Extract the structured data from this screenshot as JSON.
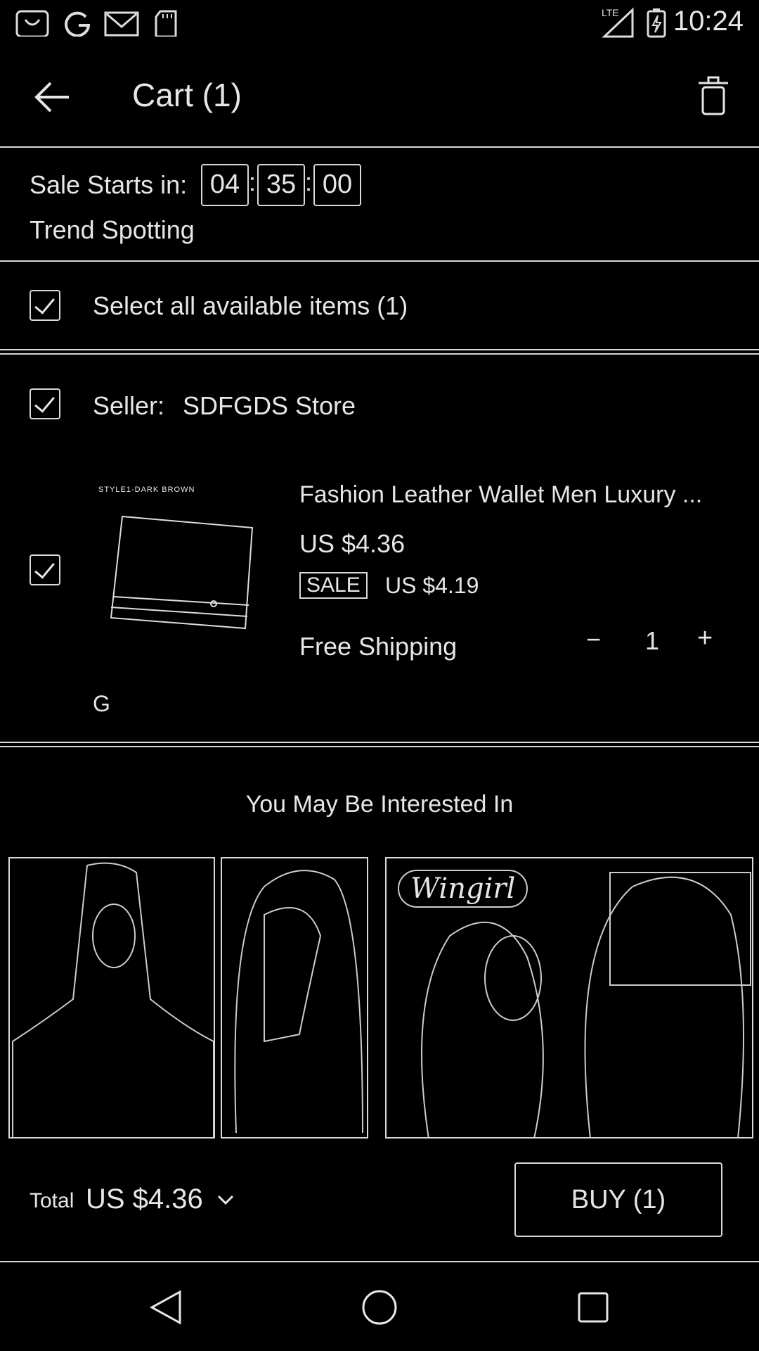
{
  "status_bar": {
    "time": "10:24",
    "left_icons": [
      "aliexpress-icon",
      "google-icon",
      "gmail-icon",
      "sd-card-icon"
    ],
    "right_icons": [
      "lte-signal-icon",
      "battery-icon"
    ],
    "lte_label": "LTE"
  },
  "header": {
    "title": "Cart (1)",
    "back_icon": "back-arrow-icon",
    "delete_icon": "trash-icon"
  },
  "sale": {
    "label": "Sale Starts in:",
    "hours": "04",
    "minutes": "35",
    "seconds": "00",
    "sep": ":",
    "subtitle": "Trend Spotting"
  },
  "select_all": {
    "label": "Select all available items (1)",
    "checked": true
  },
  "seller": {
    "prefix": "Seller:",
    "name": "SDFGDS Store",
    "checked": true
  },
  "item": {
    "checked": true,
    "image_caption": "STYLE1-DARK BROWN",
    "title": "Fashion Leather Wallet Men Luxury ...",
    "price": "US $4.36",
    "sale_badge": "SALE",
    "sale_price": "US $4.19",
    "shipping": "Free Shipping",
    "quantity": "1",
    "minus": "−",
    "plus": "+",
    "variant": "G"
  },
  "recommend": {
    "heading": "You May Be Interested In",
    "logo_text": "Wingirl"
  },
  "footer": {
    "total_label": "Total",
    "total_value": "US $4.36",
    "buy_label": "BUY (1)"
  },
  "nav": {
    "back": "nav-back-icon",
    "home": "nav-home-icon",
    "recents": "nav-recents-icon"
  }
}
